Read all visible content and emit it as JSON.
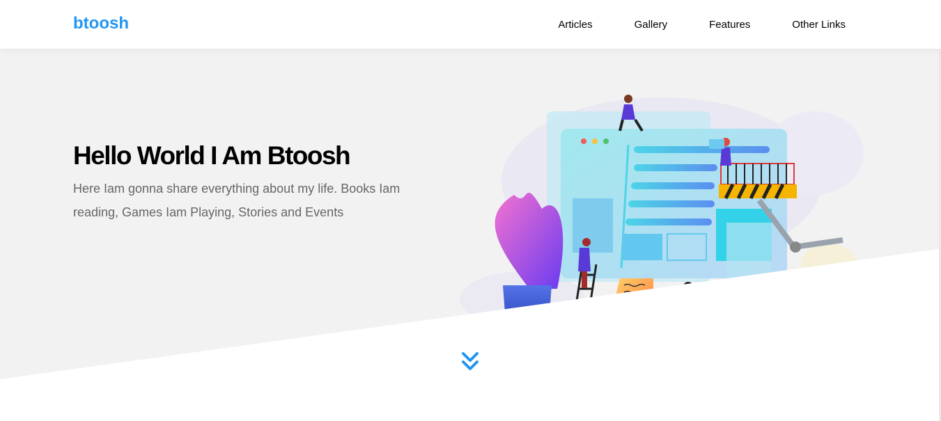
{
  "header": {
    "logo": "btoosh",
    "nav": [
      "Articles",
      "Gallery",
      "Features",
      "Other Links"
    ]
  },
  "landing": {
    "title": "Hello World I Am Btoosh",
    "description": "Here Iam gonna share everything about my life. Books Iam reading, Games Iam Playing, Stories and Events"
  },
  "icons": {
    "scroll_down": "angles-down-icon"
  },
  "colors": {
    "brand": "#2196f3",
    "landing_bg": "#f2f2f2",
    "text_muted": "#666666"
  }
}
